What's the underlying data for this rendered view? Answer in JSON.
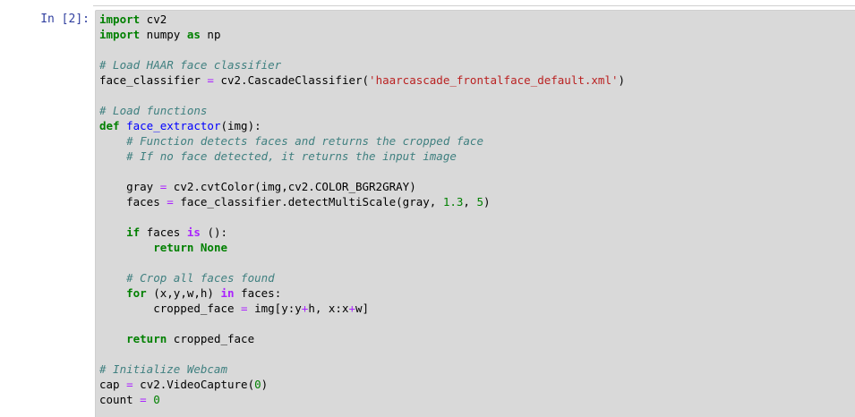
{
  "cell": {
    "prompt": "In [2]:",
    "lines": [
      [
        {
          "t": "kw",
          "v": "import"
        },
        {
          "t": "n",
          "v": " cv2"
        }
      ],
      [
        {
          "t": "kw",
          "v": "import"
        },
        {
          "t": "n",
          "v": " numpy "
        },
        {
          "t": "kw",
          "v": "as"
        },
        {
          "t": "n",
          "v": " np"
        }
      ],
      [],
      [
        {
          "t": "cm",
          "v": "# Load HAAR face classifier"
        }
      ],
      [
        {
          "t": "n",
          "v": "face_classifier "
        },
        {
          "t": "op",
          "v": "="
        },
        {
          "t": "n",
          "v": " cv2.CascadeClassifier("
        },
        {
          "t": "st",
          "v": "'haarcascade_frontalface_default.xml'"
        },
        {
          "t": "n",
          "v": ")"
        }
      ],
      [],
      [
        {
          "t": "cm",
          "v": "# Load functions"
        }
      ],
      [
        {
          "t": "kw",
          "v": "def"
        },
        {
          "t": "n",
          "v": " "
        },
        {
          "t": "fn",
          "v": "face_extractor"
        },
        {
          "t": "n",
          "v": "(img):"
        }
      ],
      [
        {
          "t": "n",
          "v": "    "
        },
        {
          "t": "cm",
          "v": "# Function detects faces and returns the cropped face"
        }
      ],
      [
        {
          "t": "n",
          "v": "    "
        },
        {
          "t": "cm",
          "v": "# If no face detected, it returns the input image"
        }
      ],
      [],
      [
        {
          "t": "n",
          "v": "    gray "
        },
        {
          "t": "op",
          "v": "="
        },
        {
          "t": "n",
          "v": " cv2.cvtColor(img,cv2.COLOR_BGR2GRAY)"
        }
      ],
      [
        {
          "t": "n",
          "v": "    faces "
        },
        {
          "t": "op",
          "v": "="
        },
        {
          "t": "n",
          "v": " face_classifier.detectMultiScale(gray, "
        },
        {
          "t": "nm",
          "v": "1.3"
        },
        {
          "t": "n",
          "v": ", "
        },
        {
          "t": "nm",
          "v": "5"
        },
        {
          "t": "n",
          "v": ")"
        }
      ],
      [],
      [
        {
          "t": "n",
          "v": "    "
        },
        {
          "t": "kw",
          "v": "if"
        },
        {
          "t": "n",
          "v": " faces "
        },
        {
          "t": "ow",
          "v": "is"
        },
        {
          "t": "n",
          "v": " ():"
        }
      ],
      [
        {
          "t": "n",
          "v": "        "
        },
        {
          "t": "kw",
          "v": "return"
        },
        {
          "t": "n",
          "v": " "
        },
        {
          "t": "kw",
          "v": "None"
        }
      ],
      [],
      [
        {
          "t": "n",
          "v": "    "
        },
        {
          "t": "cm",
          "v": "# Crop all faces found"
        }
      ],
      [
        {
          "t": "n",
          "v": "    "
        },
        {
          "t": "kw",
          "v": "for"
        },
        {
          "t": "n",
          "v": " (x,y,w,h) "
        },
        {
          "t": "ow",
          "v": "in"
        },
        {
          "t": "n",
          "v": " faces:"
        }
      ],
      [
        {
          "t": "n",
          "v": "        cropped_face "
        },
        {
          "t": "op",
          "v": "="
        },
        {
          "t": "n",
          "v": " img[y:y"
        },
        {
          "t": "op",
          "v": "+"
        },
        {
          "t": "n",
          "v": "h, x:x"
        },
        {
          "t": "op",
          "v": "+"
        },
        {
          "t": "n",
          "v": "w]"
        }
      ],
      [],
      [
        {
          "t": "n",
          "v": "    "
        },
        {
          "t": "kw",
          "v": "return"
        },
        {
          "t": "n",
          "v": " cropped_face"
        }
      ],
      [],
      [
        {
          "t": "cm",
          "v": "# Initialize Webcam"
        }
      ],
      [
        {
          "t": "n",
          "v": "cap "
        },
        {
          "t": "op",
          "v": "="
        },
        {
          "t": "n",
          "v": " cv2.VideoCapture("
        },
        {
          "t": "nm",
          "v": "0"
        },
        {
          "t": "n",
          "v": ")"
        }
      ],
      [
        {
          "t": "n",
          "v": "count "
        },
        {
          "t": "op",
          "v": "="
        },
        {
          "t": "n",
          "v": " "
        },
        {
          "t": "nm",
          "v": "0"
        }
      ]
    ]
  }
}
